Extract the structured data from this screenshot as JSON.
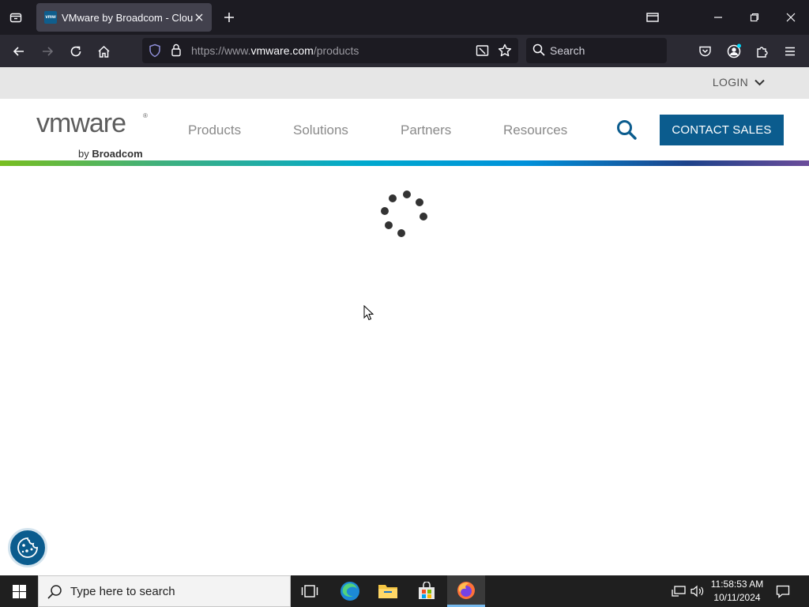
{
  "browser": {
    "tab_title": "VMware by Broadcom - Cloud Computing",
    "favicon_text": "vmw",
    "url_prefix": "https://www.",
    "url_domain": "vmware.com",
    "url_path": "/products",
    "search_placeholder": "Search"
  },
  "utility_bar": {
    "login_label": "LOGIN"
  },
  "header": {
    "logo_text": "vmware",
    "logo_by": "by ",
    "logo_brand": "Broadcom",
    "nav": [
      "Products",
      "Solutions",
      "Partners",
      "Resources"
    ],
    "cta_label": "CONTACT SALES"
  },
  "colors": {
    "brand_blue": "#0b5c8e",
    "chrome_dark": "#1c1b22",
    "taskbar": "#1f1f1f"
  },
  "taskbar": {
    "search_placeholder": "Type here to search",
    "time": "11:58:53 AM",
    "date": "10/11/2024",
    "apps": [
      "task-view-icon",
      "edge-icon",
      "file-explorer-icon",
      "store-icon",
      "firefox-icon"
    ]
  }
}
